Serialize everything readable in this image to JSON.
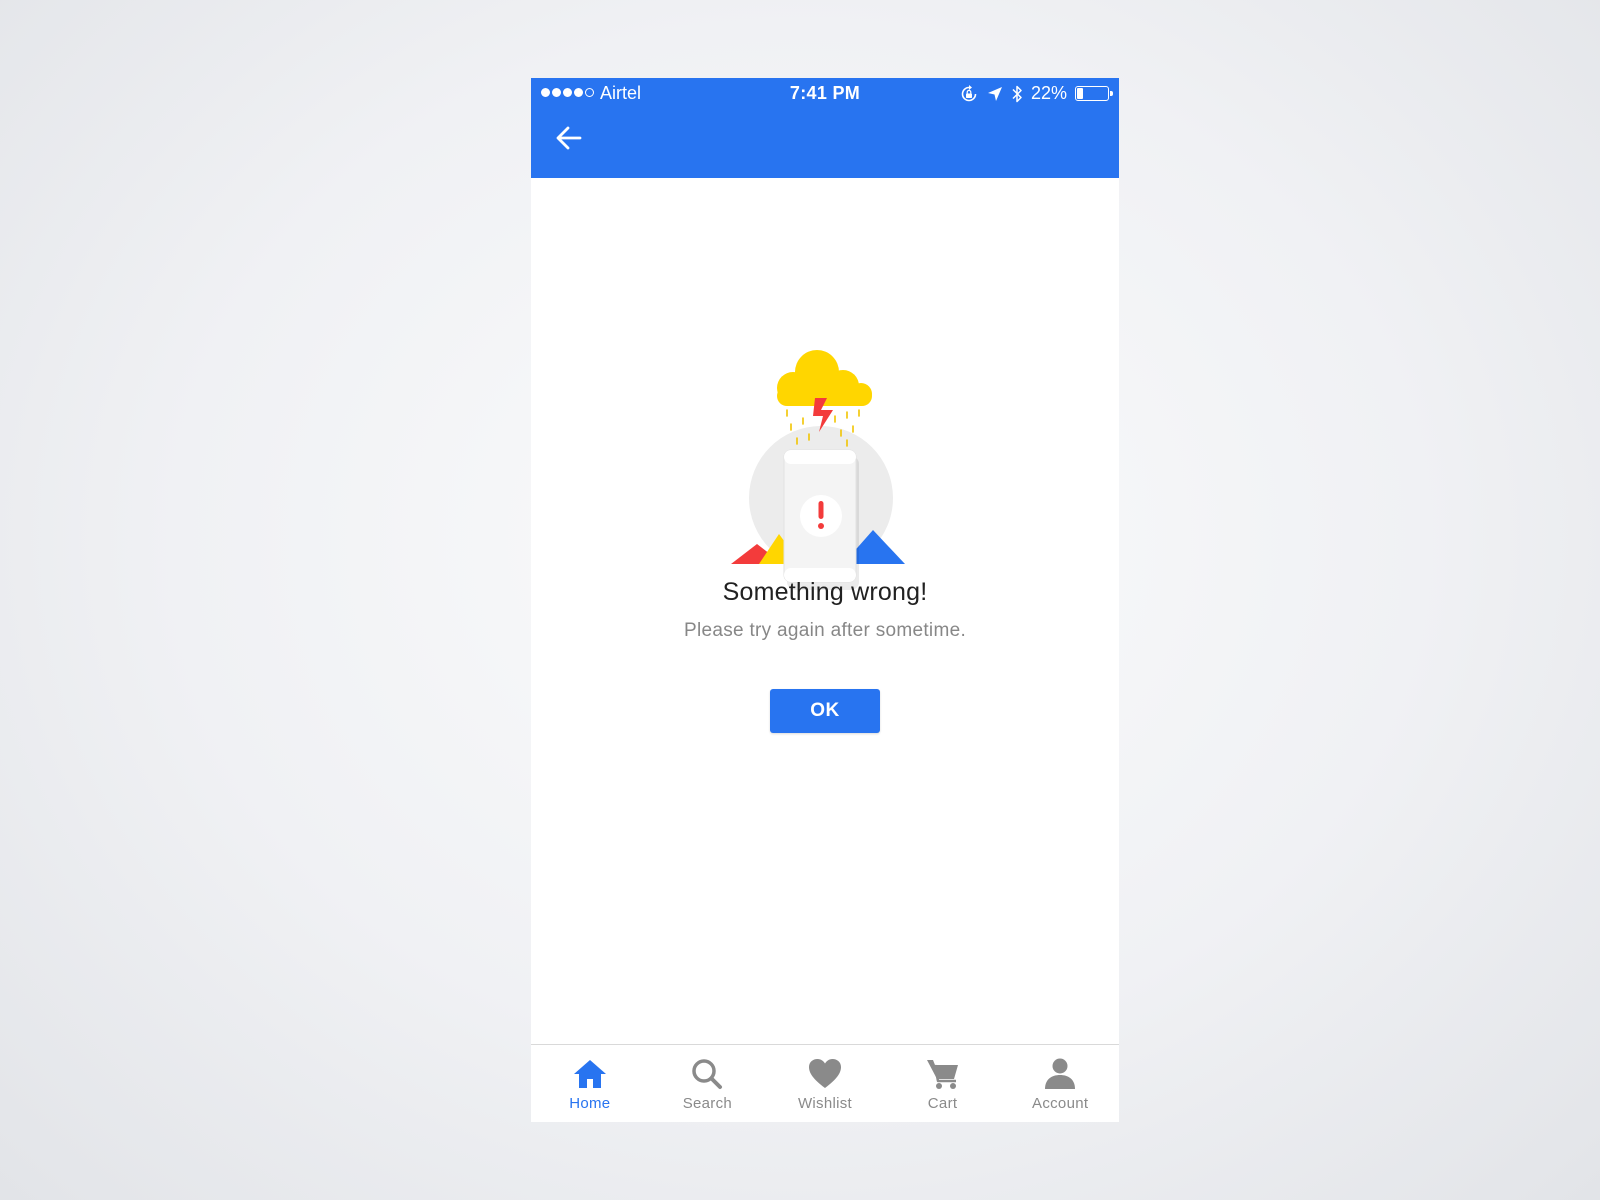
{
  "status_bar": {
    "carrier": "Airtel",
    "time": "7:41 PM",
    "battery_percent": "22%",
    "battery_level": 0.22,
    "signal_bars_filled": 4,
    "signal_bars_total": 5,
    "icons": [
      "orientation-lock-icon",
      "location-arrow-icon",
      "bluetooth-icon",
      "battery-icon"
    ]
  },
  "header": {
    "back_icon": "arrow-left-icon",
    "background_color": "#2874f0"
  },
  "error": {
    "illustration": "error-cloud-phone-illustration",
    "title": "Something wrong!",
    "message": "Please try again after sometime.",
    "ok_label": "OK"
  },
  "bottom_nav": {
    "active_index": 0,
    "active_color": "#2874f0",
    "inactive_color": "#8a8a8a",
    "items": [
      {
        "label": "Home",
        "icon": "home-icon"
      },
      {
        "label": "Search",
        "icon": "search-icon"
      },
      {
        "label": "Wishlist",
        "icon": "heart-icon"
      },
      {
        "label": "Cart",
        "icon": "cart-icon"
      },
      {
        "label": "Account",
        "icon": "account-icon"
      }
    ]
  }
}
